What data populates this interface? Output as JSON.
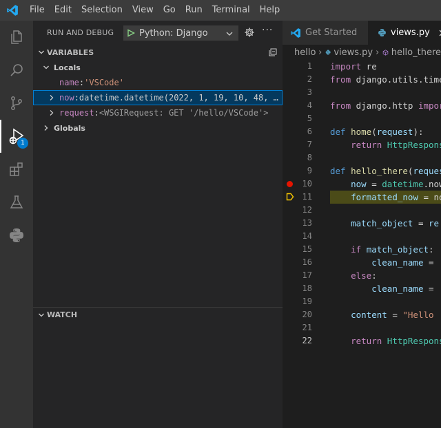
{
  "menu": [
    "File",
    "Edit",
    "Selection",
    "View",
    "Go",
    "Run",
    "Terminal",
    "Help"
  ],
  "activity": {
    "items": [
      "explorer",
      "search",
      "source-control",
      "run-and-debug",
      "extensions",
      "testing",
      "python"
    ],
    "debug_badge": "1"
  },
  "sidebar": {
    "title": "RUN AND DEBUG",
    "config": "Python: Django",
    "more": "···",
    "variables": {
      "header": "VARIABLES",
      "locals_label": "Locals",
      "name_var": {
        "name": "name",
        "sep": ": ",
        "value": "'VSCode'"
      },
      "now_var": {
        "name": "now",
        "sep": ": ",
        "value": "datetime.datetime(2022, 1, 19, 10, 48, …"
      },
      "request_var": {
        "name": "request",
        "sep": ": ",
        "value": "<WSGIRequest: GET '/hello/VSCode'>"
      },
      "globals_label": "Globals"
    },
    "watch_header": "WATCH"
  },
  "editor": {
    "tabs": [
      {
        "label": "Get Started",
        "active": false
      },
      {
        "label": "views.py",
        "active": true
      }
    ],
    "breadcrumb": [
      "hello",
      "views.py",
      "hello_there"
    ],
    "current_line": 11,
    "breakpoint_line": 10,
    "lines": [
      {
        "n": "1",
        "t": [
          {
            "c": "kc",
            "s": "import"
          },
          {
            "c": "p",
            "s": " re"
          }
        ]
      },
      {
        "n": "2",
        "t": [
          {
            "c": "kc",
            "s": "from"
          },
          {
            "c": "p",
            "s": " django.utils.timezone"
          }
        ]
      },
      {
        "n": "3",
        "t": []
      },
      {
        "n": "4",
        "t": [
          {
            "c": "kc",
            "s": "from"
          },
          {
            "c": "p",
            "s": " django.http "
          },
          {
            "c": "kc",
            "s": "import"
          }
        ]
      },
      {
        "n": "5",
        "t": []
      },
      {
        "n": "6",
        "t": [
          {
            "c": "k",
            "s": "def"
          },
          {
            "c": "p",
            "s": " "
          },
          {
            "c": "f",
            "s": "home"
          },
          {
            "c": "p",
            "s": "("
          },
          {
            "c": "v",
            "s": "request"
          },
          {
            "c": "p",
            "s": "):"
          }
        ]
      },
      {
        "n": "7",
        "t": [
          {
            "c": "p",
            "s": "    "
          },
          {
            "c": "kc",
            "s": "return"
          },
          {
            "c": "p",
            "s": " "
          },
          {
            "c": "t",
            "s": "HttpResponse"
          }
        ]
      },
      {
        "n": "8",
        "t": []
      },
      {
        "n": "9",
        "t": [
          {
            "c": "k",
            "s": "def"
          },
          {
            "c": "p",
            "s": " "
          },
          {
            "c": "f",
            "s": "hello_there"
          },
          {
            "c": "p",
            "s": "("
          },
          {
            "c": "v",
            "s": "request"
          }
        ]
      },
      {
        "n": "10",
        "t": [
          {
            "c": "p",
            "s": "    "
          },
          {
            "c": "v",
            "s": "now"
          },
          {
            "c": "p",
            "s": " = "
          },
          {
            "c": "t",
            "s": "datetime"
          },
          {
            "c": "p",
            "s": ".now"
          }
        ]
      },
      {
        "n": "11",
        "t": [
          {
            "c": "p",
            "s": "    "
          },
          {
            "c": "v",
            "s": "formatted_now"
          },
          {
            "c": "p",
            "s": " = now"
          }
        ]
      },
      {
        "n": "12",
        "t": []
      },
      {
        "n": "13",
        "t": [
          {
            "c": "p",
            "s": "    "
          },
          {
            "c": "v",
            "s": "match_object"
          },
          {
            "c": "p",
            "s": " = "
          },
          {
            "c": "v",
            "s": "re"
          }
        ]
      },
      {
        "n": "14",
        "t": []
      },
      {
        "n": "15",
        "t": [
          {
            "c": "p",
            "s": "    "
          },
          {
            "c": "kc",
            "s": "if"
          },
          {
            "c": "p",
            "s": " "
          },
          {
            "c": "v",
            "s": "match_object"
          },
          {
            "c": "p",
            "s": ":"
          }
        ]
      },
      {
        "n": "16",
        "t": [
          {
            "c": "p",
            "s": "        "
          },
          {
            "c": "v",
            "s": "clean_name"
          },
          {
            "c": "p",
            "s": " = "
          }
        ]
      },
      {
        "n": "17",
        "t": [
          {
            "c": "p",
            "s": "    "
          },
          {
            "c": "kc",
            "s": "else"
          },
          {
            "c": "p",
            "s": ":"
          }
        ]
      },
      {
        "n": "18",
        "t": [
          {
            "c": "p",
            "s": "        "
          },
          {
            "c": "v",
            "s": "clean_name"
          },
          {
            "c": "p",
            "s": " = "
          }
        ]
      },
      {
        "n": "19",
        "t": []
      },
      {
        "n": "20",
        "t": [
          {
            "c": "p",
            "s": "    "
          },
          {
            "c": "v",
            "s": "content"
          },
          {
            "c": "p",
            "s": " = "
          },
          {
            "c": "s",
            "s": "\"Hello"
          }
        ]
      },
      {
        "n": "21",
        "t": []
      },
      {
        "n": "22",
        "t": [
          {
            "c": "p",
            "s": "    "
          },
          {
            "c": "kc",
            "s": "return"
          },
          {
            "c": "p",
            "s": " "
          },
          {
            "c": "t",
            "s": "HttpResponse"
          }
        ]
      }
    ]
  }
}
